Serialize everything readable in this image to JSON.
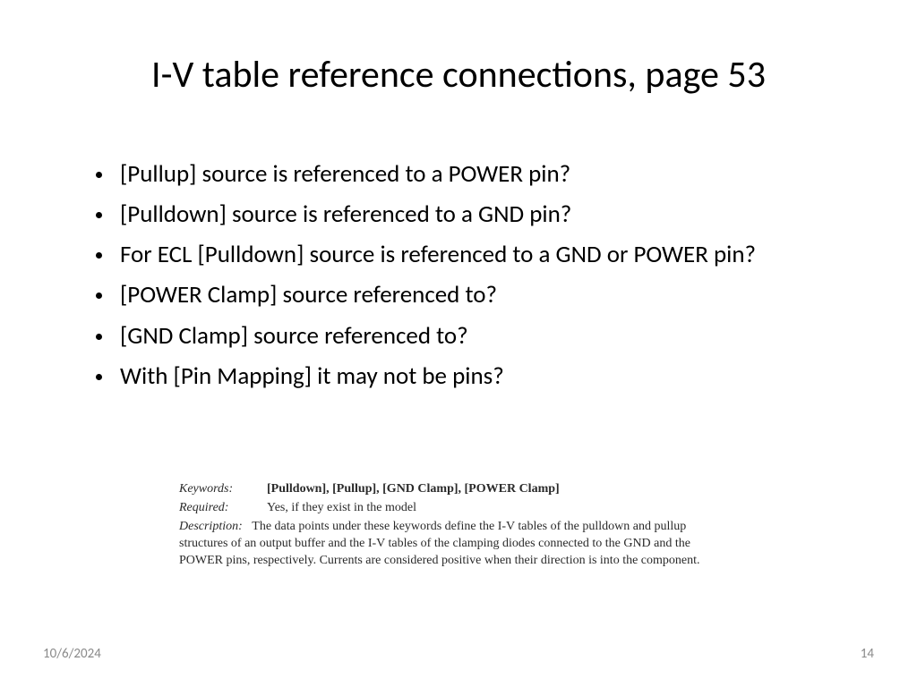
{
  "title": "I-V table reference connections, page 53",
  "bullets": [
    "[Pullup] source is referenced to a POWER pin?",
    "[Pulldown] source is referenced to a GND pin?",
    "For ECL [Pulldown] source is referenced to a GND or POWER pin?",
    "[POWER Clamp] source referenced to?",
    "[GND Clamp] source referenced to?",
    "With [Pin Mapping] it may not be pins?"
  ],
  "excerpt": {
    "keywords_label": "Keywords:",
    "keywords_value": "[Pulldown], [Pullup], [GND Clamp], [POWER Clamp]",
    "required_label": "Required:",
    "required_value": "Yes, if they exist in the model",
    "description_label": "Description:",
    "description_value": "The data points under these keywords define the I-V tables of the pulldown and pullup structures of an output buffer and the I-V tables of the clamping diodes connected to the GND and the POWER pins, respectively.  Currents are considered positive when their direction is into the component."
  },
  "footer": {
    "date": "10/6/2024",
    "page": "14"
  }
}
